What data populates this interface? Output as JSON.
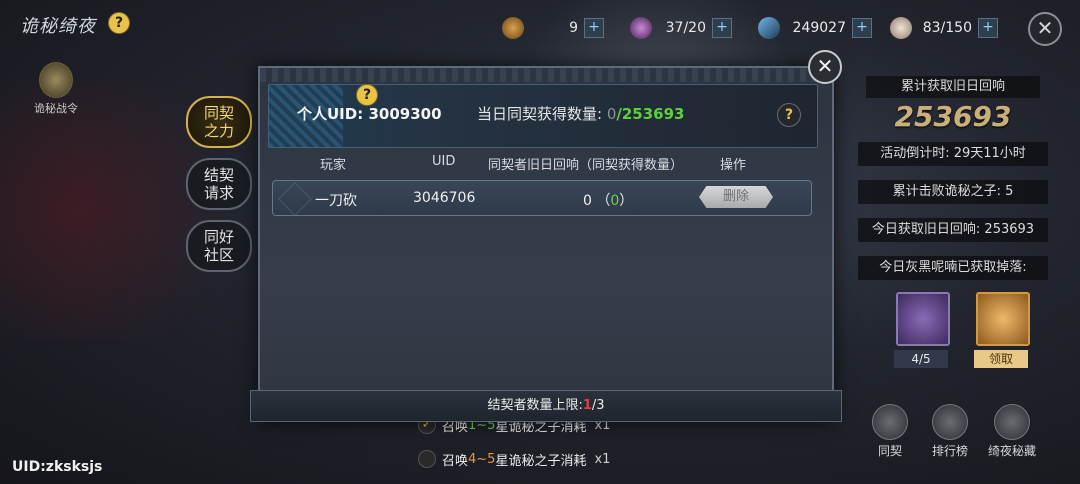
{
  "game": {
    "title": "诡秘绮夜"
  },
  "resources": [
    {
      "icon": "potion-bag-icon",
      "value": "9"
    },
    {
      "icon": "purple-potion-icon",
      "value": "37/20"
    },
    {
      "icon": "sword-icon",
      "value": "249027"
    },
    {
      "icon": "feather-icon",
      "value": "83/150"
    }
  ],
  "left_shortcut": {
    "label": "诡秘战令"
  },
  "side_tabs": [
    {
      "label": "同契之力",
      "line1": "同契",
      "line2": "之力"
    },
    {
      "label": "结契请求",
      "line1": "结契",
      "line2": "请求"
    },
    {
      "label": "同好社区",
      "line1": "同好",
      "line2": "社区"
    }
  ],
  "modal": {
    "personal_uid_label": "个人UID:",
    "personal_uid": "3009300",
    "daily_label": "当日同契获得数量:",
    "daily_current": "0",
    "daily_total": "/253693",
    "columns": {
      "player": "玩家",
      "uid": "UID",
      "echo": "同契者旧日回响（同契获得数量）",
      "action": "操作"
    },
    "rows": [
      {
        "player": "一刀砍",
        "uid": "3046706",
        "echo": "0",
        "gained": "0",
        "action": "删除"
      }
    ],
    "footer_label": "结契者数量上限:",
    "footer_current": "1",
    "footer_max": "/3"
  },
  "right_panel": {
    "title": "累计获取旧日回响",
    "big_value": "253693",
    "countdown": "活动倒计时: 29天11小时",
    "defeated": "累计击败诡秘之子: 5",
    "today_echo": "今日获取旧日回响: 253693",
    "drops_title": "今日灰黑呢喃已获取掉落:",
    "reward1_label": "4/5",
    "reward2_label": "领取",
    "bottom_icons": [
      "同契",
      "排行榜",
      "绮夜秘藏"
    ]
  },
  "tasks": [
    {
      "prefix": "召唤",
      "range": "1~5",
      "suffix": "星诡秘之子消耗",
      "mult": "x1",
      "checked": true
    },
    {
      "prefix": "召唤",
      "range": "4~5",
      "suffix": "星诡秘之子消耗",
      "mult": "x1",
      "checked": false
    }
  ],
  "footer_uid": "UID:zksksjs",
  "colors": {
    "accent_gold": "#d8b14a",
    "green": "#60cf3f",
    "red": "#e04040"
  }
}
